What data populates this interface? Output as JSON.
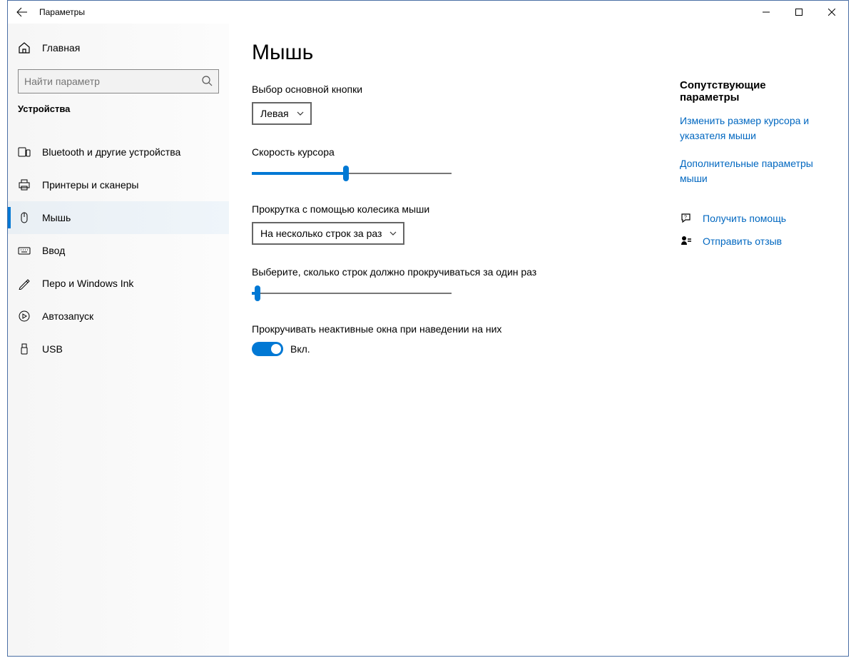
{
  "window": {
    "title": "Параметры"
  },
  "sidebar": {
    "home": "Главная",
    "search_placeholder": "Найти параметр",
    "category": "Устройства",
    "items": [
      {
        "label": "Bluetooth и другие устройства",
        "icon": "bluetooth"
      },
      {
        "label": "Принтеры и сканеры",
        "icon": "printer"
      },
      {
        "label": "Мышь",
        "icon": "mouse",
        "selected": true
      },
      {
        "label": "Ввод",
        "icon": "keyboard"
      },
      {
        "label": "Перо и Windows Ink",
        "icon": "pen"
      },
      {
        "label": "Автозапуск",
        "icon": "autoplay"
      },
      {
        "label": "USB",
        "icon": "usb"
      }
    ]
  },
  "main": {
    "title": "Мышь",
    "primary_button": {
      "label": "Выбор основной кнопки",
      "value": "Левая"
    },
    "cursor_speed": {
      "label": "Скорость курсора",
      "percent": 47
    },
    "wheel_mode": {
      "label": "Прокрутка с помощью колесика мыши",
      "value": "На несколько строк за раз"
    },
    "lines": {
      "label": "Выберите, сколько строк должно прокручиваться за один раз",
      "percent": 3
    },
    "inactive": {
      "label": "Прокручивать неактивные окна при наведении на них",
      "state": "Вкл."
    }
  },
  "aside": {
    "related_heading": "Сопутствующие параметры",
    "links": [
      "Изменить размер курсора и указателя мыши",
      "Дополнительные параметры мыши"
    ],
    "help": "Получить помощь",
    "feedback": "Отправить отзыв"
  }
}
